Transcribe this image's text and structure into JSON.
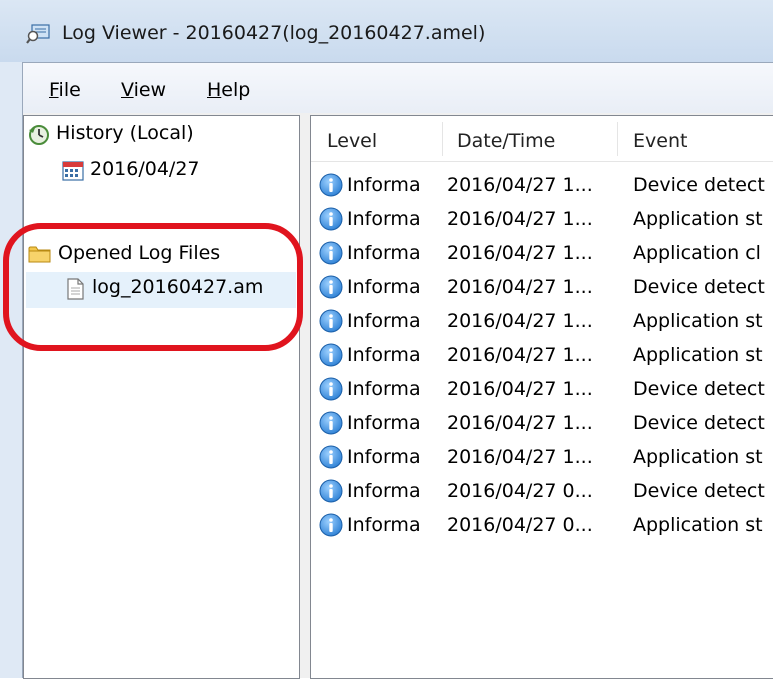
{
  "window": {
    "title": "Log Viewer - 20160427(log_20160427.amel)"
  },
  "menu": {
    "file_label_u": "F",
    "file_label_rest": "ile",
    "view_label_u": "V",
    "view_label_rest": "iew",
    "help_label_u": "H",
    "help_label_rest": "elp"
  },
  "tree": {
    "history_label": "History (Local)",
    "history_date": "2016/04/27",
    "opened_label": "Opened Log Files",
    "opened_file": "log_20160427.am"
  },
  "list": {
    "columns": [
      "Level",
      "Date/Time",
      "Event"
    ],
    "rows": [
      {
        "level": "Informa",
        "datetime": "2016/04/27 1...",
        "event": "Device detect"
      },
      {
        "level": "Informa",
        "datetime": "2016/04/27 1...",
        "event": "Application st"
      },
      {
        "level": "Informa",
        "datetime": "2016/04/27 1...",
        "event": "Application cl"
      },
      {
        "level": "Informa",
        "datetime": "2016/04/27 1...",
        "event": "Device detect"
      },
      {
        "level": "Informa",
        "datetime": "2016/04/27 1...",
        "event": "Application st"
      },
      {
        "level": "Informa",
        "datetime": "2016/04/27 1...",
        "event": "Application st"
      },
      {
        "level": "Informa",
        "datetime": "2016/04/27 1...",
        "event": "Device detect"
      },
      {
        "level": "Informa",
        "datetime": "2016/04/27 1...",
        "event": "Device detect"
      },
      {
        "level": "Informa",
        "datetime": "2016/04/27 1...",
        "event": "Application st"
      },
      {
        "level": "Informa",
        "datetime": "2016/04/27 0...",
        "event": "Device detect"
      },
      {
        "level": "Informa",
        "datetime": "2016/04/27 0...",
        "event": "Application st"
      }
    ]
  },
  "colors": {
    "highlight": "#e0141e",
    "info_icon": "#2b7fd4",
    "selection": "#e5f1fb"
  },
  "icons": {
    "app": "log-viewer-icon",
    "history": "history-icon",
    "calendar": "calendar-icon",
    "folder": "folder-icon",
    "file": "file-icon",
    "info": "info-icon"
  }
}
